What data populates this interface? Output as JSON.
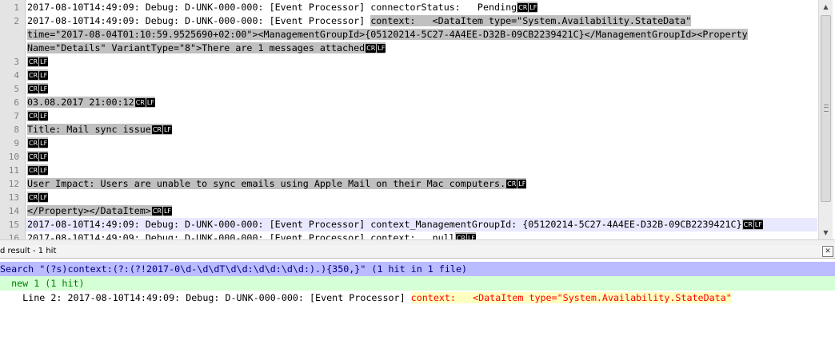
{
  "editor": {
    "lines": [
      {
        "num": "1",
        "segments": [
          {
            "text": "2017-08-10T14:49:09: Debug: D-UNK-000-000: [Event Processor] connectorStatus:   Pending",
            "sel": false
          }
        ],
        "eol": true
      },
      {
        "num": "2",
        "segments": [
          {
            "text": "2017-08-10T14:49:09: Debug: D-UNK-000-000: [Event Processor] ",
            "sel": false
          },
          {
            "text": "context:   <DataItem type=\"System.Availability.StateData\"",
            "sel": true
          }
        ],
        "eol": false
      },
      {
        "num": "",
        "segments": [
          {
            "text": "time=\"2017-08-04T01:10:59.9525690+02:00\"><ManagementGroupId>{05120214-5C27-4A4EE-D32B-09CB2239421C}</ManagementGroupId><Property",
            "sel": true
          }
        ],
        "eol": false
      },
      {
        "num": "",
        "segments": [
          {
            "text": "Name=\"Details\" VariantType=\"8\">There are 1 messages attached",
            "sel": true
          }
        ],
        "eol": true
      },
      {
        "num": "3",
        "segments": [],
        "eol": true
      },
      {
        "num": "4",
        "segments": [],
        "eol": true
      },
      {
        "num": "5",
        "segments": [],
        "eol": true
      },
      {
        "num": "6",
        "segments": [
          {
            "text": "03.08.2017 21:00:12",
            "sel": true
          }
        ],
        "eol": true
      },
      {
        "num": "7",
        "segments": [],
        "eol": true
      },
      {
        "num": "8",
        "segments": [
          {
            "text": "Title: Mail sync issue",
            "sel": true
          }
        ],
        "eol": true
      },
      {
        "num": "9",
        "segments": [],
        "eol": true
      },
      {
        "num": "10",
        "segments": [],
        "eol": true
      },
      {
        "num": "11",
        "segments": [],
        "eol": true
      },
      {
        "num": "12",
        "segments": [
          {
            "text": "User Impact: Users are unable to sync emails using Apple Mail on their Mac computers.",
            "sel": true
          }
        ],
        "eol": true
      },
      {
        "num": "13",
        "segments": [],
        "eol": true
      },
      {
        "num": "14",
        "segments": [
          {
            "text": "</Property></DataItem>",
            "sel": true
          }
        ],
        "eol": true
      },
      {
        "num": "15",
        "segments": [
          {
            "text": "2017-08-10T14:49:09: Debug: D-UNK-000-000: [Event Processor] context_ManagementGroupId: {05120214-5C27-4A4EE-D32B-09CB2239421C}",
            "sel": false
          }
        ],
        "eol": true,
        "current": true
      },
      {
        "num": "16",
        "segments": [
          {
            "text": "2017-08-10T14:49:09: Debug: D-UNK-000-000: [Event Processor] context:   null",
            "sel": false
          }
        ],
        "eol": true
      }
    ],
    "eol_cr": "CR",
    "eol_lf": "LF"
  },
  "panel": {
    "title": "d result - 1 hit",
    "close": "✕"
  },
  "results": {
    "search_line": "Search \"(?s)context:(?:(?!2017-0\\d-\\d\\dT\\d\\d:\\d\\d:\\d\\d:).){350,}\" (1 hit in 1 file)",
    "file_line": "  new 1 (1 hit)",
    "hit_prefix": "    Line 2: 2017-08-10T14:49:09: Debug: D-UNK-000-000: [Event Processor] ",
    "hit_match": "context:   <DataItem type=\"System.Availability.StateData\""
  },
  "colors": {
    "selection": "#c0c0c0",
    "current_line": "#e8e8ff",
    "search_header_bg": "#bbbbff",
    "file_row_bg": "#d5ffd5",
    "match_bg": "#ffffbf",
    "match_fg": "#ff0000"
  },
  "icons": {
    "scroll_up": "▲",
    "scroll_down": "▼",
    "scroll_grip": "grip-icon"
  }
}
